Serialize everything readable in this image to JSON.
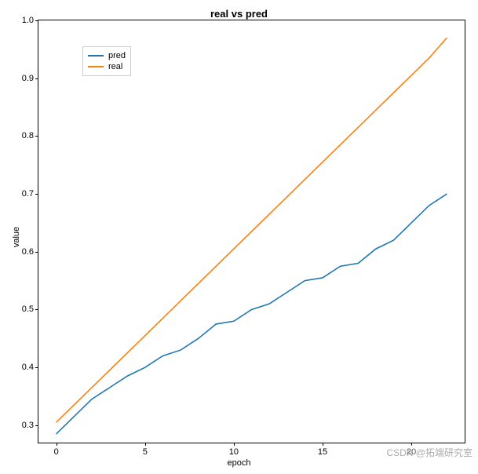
{
  "chart_data": {
    "type": "line",
    "title": "real vs pred",
    "xlabel": "epoch",
    "ylabel": "value",
    "xlim": [
      -1,
      23
    ],
    "ylim": [
      0.27,
      1.0
    ],
    "x": [
      0,
      1,
      2,
      3,
      4,
      5,
      6,
      7,
      8,
      9,
      10,
      11,
      12,
      13,
      14,
      15,
      16,
      17,
      18,
      19,
      20,
      21,
      22
    ],
    "series": [
      {
        "name": "pred",
        "color": "#1f77b4",
        "values": [
          0.285,
          0.315,
          0.345,
          0.365,
          0.385,
          0.4,
          0.42,
          0.43,
          0.45,
          0.475,
          0.48,
          0.5,
          0.51,
          0.53,
          0.55,
          0.555,
          0.575,
          0.58,
          0.605,
          0.62,
          0.65,
          0.68,
          0.7
        ]
      },
      {
        "name": "real",
        "color": "#ff7f0e",
        "values": [
          0.305,
          0.335,
          0.365,
          0.395,
          0.425,
          0.455,
          0.485,
          0.515,
          0.545,
          0.575,
          0.605,
          0.635,
          0.665,
          0.695,
          0.725,
          0.755,
          0.785,
          0.815,
          0.845,
          0.875,
          0.905,
          0.935,
          0.97
        ]
      }
    ],
    "xticks": [
      0,
      5,
      10,
      15,
      20
    ],
    "yticks": [
      0.3,
      0.4,
      0.5,
      0.6,
      0.7,
      0.8,
      0.9,
      1.0
    ],
    "legend": [
      "pred",
      "real"
    ],
    "legend_pos": "upper-left"
  },
  "watermark": "CSDN @拓端研究室"
}
